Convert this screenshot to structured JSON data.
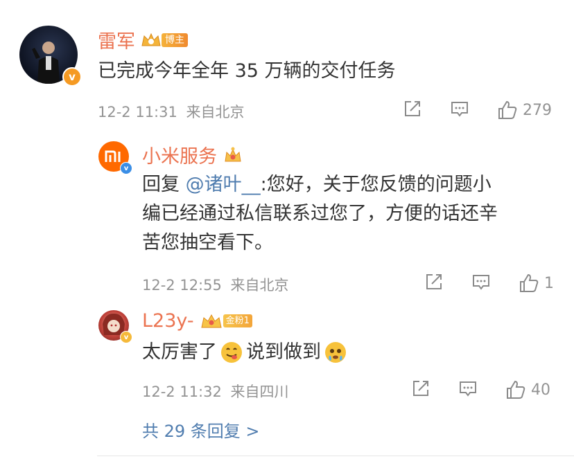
{
  "comments": [
    {
      "name": "雷军",
      "badge_label": "博主",
      "text": "已完成今年全年 35 万辆的交付任务",
      "time": "12-2 11:31",
      "location": "来自北京",
      "likes": "279"
    },
    {
      "name": "小米服务",
      "reply_prefix": "回复",
      "mention": "@诸叶__",
      "text_line1_rest": ":您好，关于您反馈的问题小",
      "text_line2": "编已经通过私信联系过您了，方便的话还辛",
      "text_line3": "苦您抽空看下。",
      "time": "12-2 12:55",
      "location": "来自北京",
      "likes": "1"
    },
    {
      "name": "L23y-",
      "fan_label": "金粉1",
      "text_part1": "太厉害了",
      "text_part2": "说到做到",
      "time": "12-2 11:32",
      "location": "来自四川",
      "likes": "40"
    }
  ],
  "more_replies": "共 29 条回复 >",
  "colors": {
    "name": "#eb7350",
    "link": "#507daf",
    "meta": "#939393",
    "verified_orange": "#f59a23",
    "verified_blue": "#3a8ee6"
  }
}
